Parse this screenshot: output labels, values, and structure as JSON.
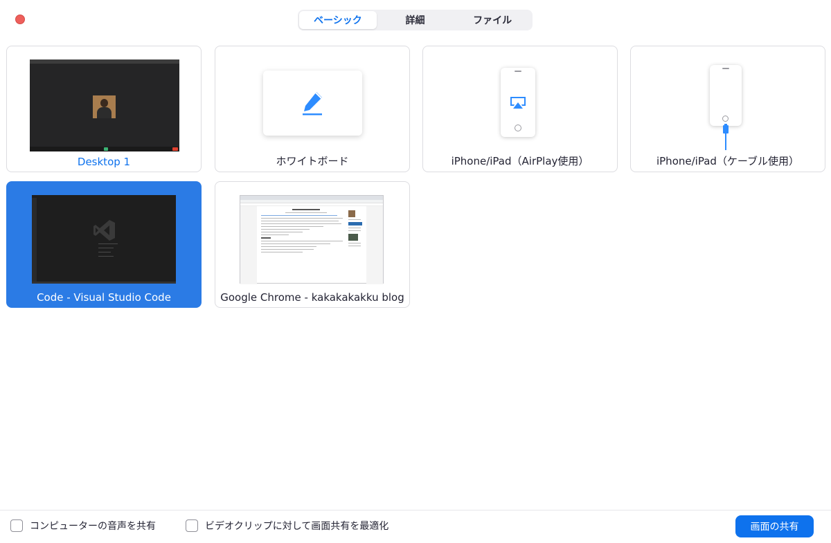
{
  "window": {
    "close_color": "#ee5f5b"
  },
  "tabs": [
    {
      "label": "ベーシック",
      "active": true
    },
    {
      "label": "詳細",
      "active": false
    },
    {
      "label": "ファイル",
      "active": false
    }
  ],
  "cards": [
    {
      "label": "Desktop 1",
      "type": "desktop",
      "selected": false
    },
    {
      "label": "ホワイトボード",
      "type": "whiteboard",
      "selected": false
    },
    {
      "label": "iPhone/iPad（AirPlay使用）",
      "type": "iphone-airplay",
      "selected": false
    },
    {
      "label": "iPhone/iPad（ケーブル使用）",
      "type": "iphone-cable",
      "selected": false
    },
    {
      "label": "Code - Visual Studio Code",
      "type": "window",
      "selected": true
    },
    {
      "label": "Google Chrome - kakakakakku blog",
      "type": "window",
      "selected": false
    }
  ],
  "footer": {
    "share_audio_label": "コンピューターの音声を共有",
    "share_audio_checked": false,
    "optimize_video_label": "ビデオクリップに対して画面共有を最適化",
    "optimize_video_checked": false,
    "share_button_label": "画面の共有"
  },
  "colors": {
    "accent": "#0e72ed",
    "selected_card": "#2b7be5",
    "airplay_blue": "#2d8cff"
  }
}
